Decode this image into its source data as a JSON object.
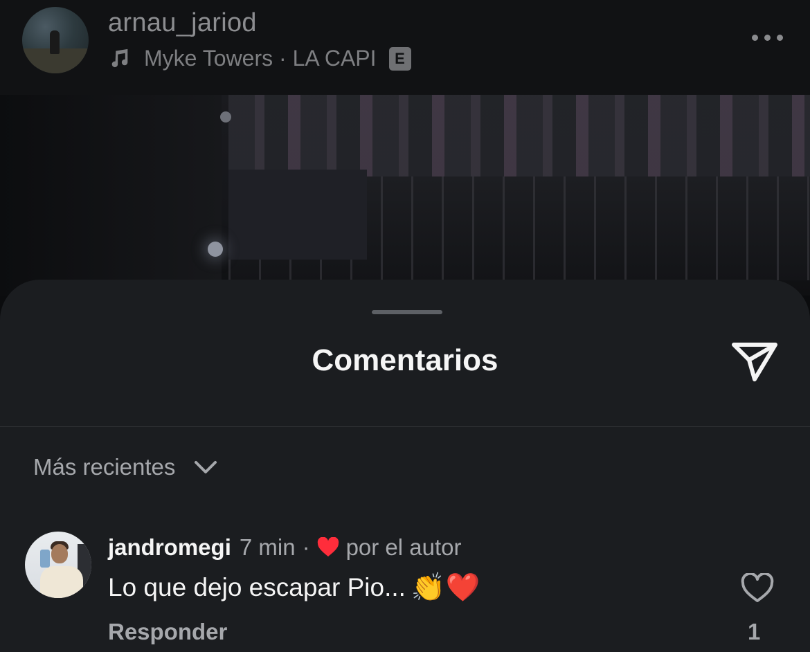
{
  "post": {
    "username": "arnau_jariod",
    "artist": "Myke Towers",
    "separator": " · ",
    "song": "LA CAPI",
    "explicit_badge": "E",
    "icons": {
      "music": "music-note-icon",
      "more": "more-dots-icon"
    }
  },
  "sheet": {
    "title": "Comentarios",
    "send_icon": "send-icon",
    "sort": {
      "label": "Más recientes",
      "icon": "chevron-down-icon"
    }
  },
  "comments": [
    {
      "username": "jandromegi",
      "time": "7 min",
      "dot": "·",
      "liked_by_author_label": "por el autor",
      "text": "Lo que dejo escapar Pio...",
      "emojis": "👏❤️",
      "reply_label": "Responder",
      "like_count": "1",
      "icons": {
        "author_heart": "heart-filled-icon",
        "like": "heart-outline-icon"
      }
    }
  ],
  "colors": {
    "sheet_bg": "#1b1d20",
    "header_bg": "#111214",
    "text_primary": "#f5f5f5",
    "text_secondary": "#a6a8ac",
    "heart_red": "#ff2d3b"
  }
}
